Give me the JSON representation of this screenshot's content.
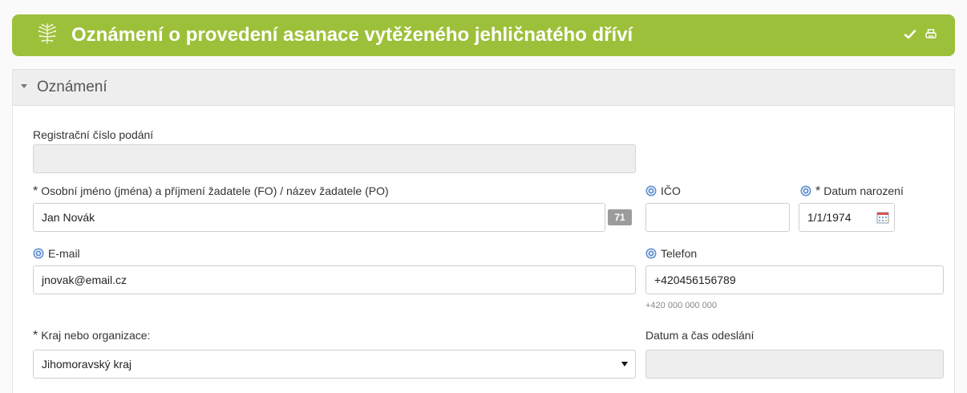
{
  "header": {
    "title": "Oznámení o provedení asanace vytěženého jehličnatého dříví",
    "logo_icon": "tree-emblem-icon",
    "actions": [
      "checkmark-icon",
      "print-icon"
    ],
    "color": "#9dc03a"
  },
  "section": {
    "title": "Oznámení",
    "toggle_icon": "caret-down-icon"
  },
  "form": {
    "reg_number": {
      "label": "Registrační číslo podání",
      "value": ""
    },
    "name": {
      "required_mark": "*",
      "label": "Osobní jméno (jména) a příjmení žadatele (FO) / název žadatele (PO)",
      "value": "Jan Novák",
      "counter": "71"
    },
    "ico": {
      "label": "IČO",
      "value": ""
    },
    "birth_date": {
      "required_mark": "*",
      "label": "Datum narození",
      "value": "1/1/1974"
    },
    "email": {
      "label": "E-mail",
      "value": "jnovak@email.cz"
    },
    "phone": {
      "label": "Telefon",
      "value": "+420456156789",
      "hint": "+420 000 000 000"
    },
    "region": {
      "required_mark": "*",
      "label": "Kraj nebo organizace:",
      "value": "Jihomoravský kraj"
    },
    "sent_at": {
      "label": "Datum a čas odeslání",
      "value": ""
    }
  }
}
